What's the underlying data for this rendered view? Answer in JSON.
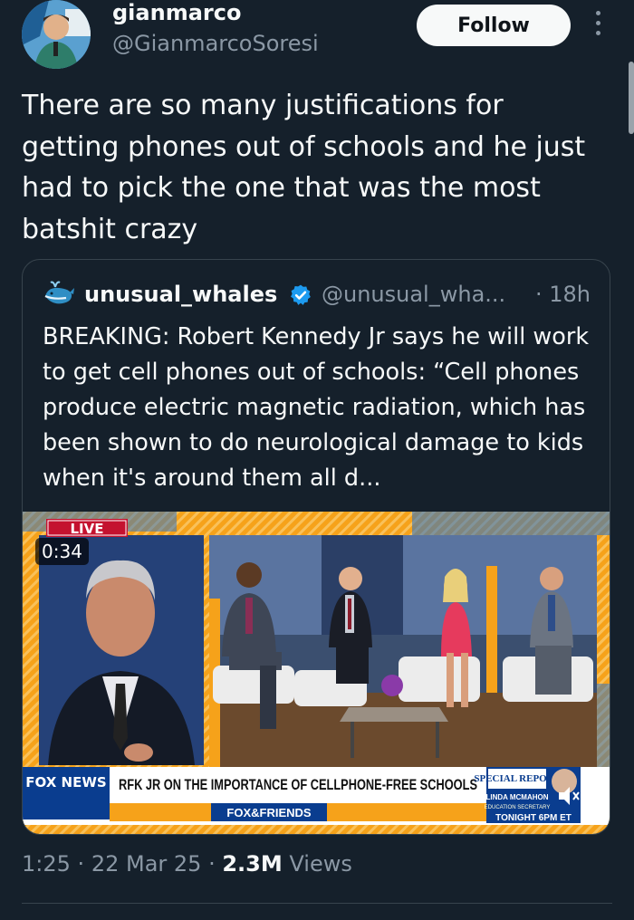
{
  "author": {
    "display_name": "gianmarco",
    "handle": "@GianmarcoSoresi"
  },
  "follow_label": "Follow",
  "tweet_text": "There are so many justifications for getting phones out of schools and he just had to pick the one that was the most batshit crazy",
  "quoted_tweet": {
    "display_name": "unusual_whales",
    "handle": "@unusual_wha...",
    "time": "· 18h",
    "text": "BREAKING: Robert Kennedy Jr says he will work to get cell phones out of schools: “Cell phones produce electric magnetic radiation, which has been shown to do neurological damage to kids when it's around them all d...",
    "video": {
      "live_label": "LIVE",
      "chyron": "RFK JR ON THE IMPORTANCE OF CELLPHONE-FREE SCHOOLS",
      "network": "FOX NEWS",
      "show": "FOX&FRIENDS",
      "promo_title": "SPECIAL REPORT",
      "promo_host": "LINDA MCMAHON",
      "promo_role": "EDUCATION SECRETARY",
      "promo_time": "TONIGHT 6PM ET",
      "duration": "0:34"
    }
  },
  "meta": {
    "time": "1:25",
    "date": "22 Mar 25",
    "views_count": "2.3M",
    "views_label": "Views"
  },
  "colors": {
    "background": "#15202b",
    "secondary_text": "#8b98a5",
    "verified": "#1d9bf0",
    "fox_orange": "#f6a21a",
    "fox_blue": "#0a3d8f"
  }
}
